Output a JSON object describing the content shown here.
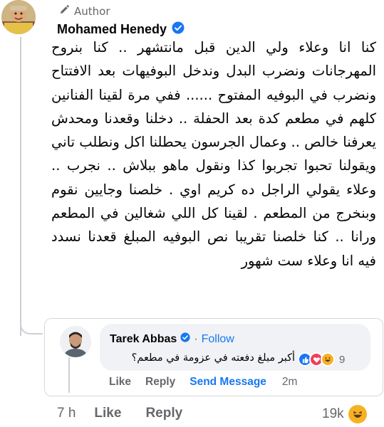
{
  "post": {
    "badge_label": "Author",
    "author_name": "Mohamed Henedy",
    "body": "كنا انا وعلاء ولي الدين قبل مانتشهر .. كنا بنروح المهرجانات ونضرب البدل وندخل البوفيهات بعد الافتتاح ونضرب في البوفيه المفتوح ...... ففي مرة لقينا الفنانين كلهم في مطعم كدة بعد الحفلة .. دخلنا وقعدنا ومحدش يعرفنا خالص .. وعمال الجرسون يحطلنا اكل ونطلب تاني ويقولنا تحبوا تجربوا كذا ونقول ماهو ببلاش .. نجرب .. وعلاء يقولي الراجل ده كريم اوي . خلصنا وجايين نقوم وبنخرج من المطعم . لقينا كل اللي شغالين في المطعم ورانا .. كنا خلصنا تقريبا نص البوفيه المبلغ قعدنا نسدد فيه انا وعلاء ست شهور",
    "time": "7 h",
    "like_label": "Like",
    "reply_label": "Reply",
    "reaction_count": "19k"
  },
  "reply": {
    "author_name": "Tarek Abbas",
    "follow_label": "Follow",
    "text": "أكبر مبلغ دفعته في عزومة في مطعم؟",
    "reaction_count": "9",
    "like_label": "Like",
    "reply_label": "Reply",
    "send_label": "Send Message",
    "time": "2m"
  },
  "colors": {
    "accent": "#1877f2",
    "bubble": "#f0f2f5",
    "muted": "#65676b"
  },
  "icons": {
    "badge": "pencil-icon",
    "verified": "verified-badge-icon",
    "reactions": [
      "like-icon",
      "love-icon",
      "haha-icon"
    ]
  }
}
